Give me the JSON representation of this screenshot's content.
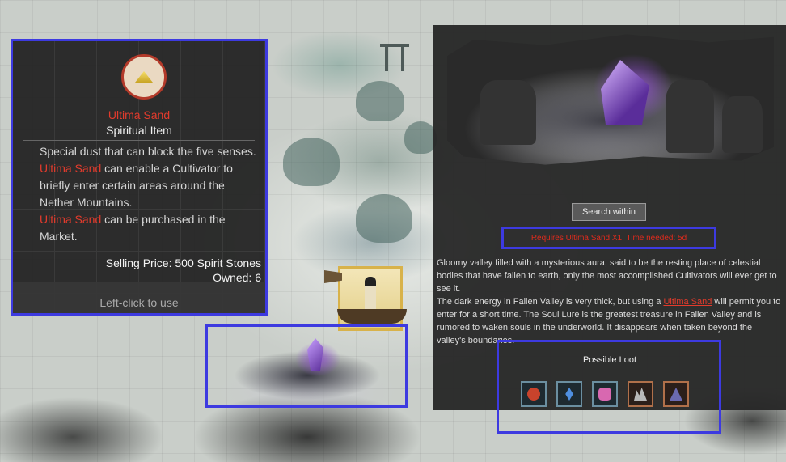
{
  "tooltip": {
    "item_name": "Ultima Sand",
    "item_type": "Spiritual Item",
    "description": [
      {
        "text": "Special dust that can block the five senses. ",
        "highlight": false
      },
      {
        "text": "Ultima Sand",
        "highlight": true
      },
      {
        "text": " can enable a Cultivator to briefly enter certain areas around the Nether Mountains.",
        "highlight": false
      }
    ],
    "description_line2_highlight": "Ultima Sand",
    "description_line2_rest": " can be purchased in the Market.",
    "selling_price": "Selling Price: 500 Spirit Stones",
    "owned": "Owned: 6",
    "use_hint": "Left-click to use"
  },
  "panel": {
    "search_button": "Search within",
    "requirements": "Requires Ultima Sand X1.   Time needed: 5d",
    "desc_para1": " Gloomy valley filled with a mysterious aura, said to be the resting place of celestial bodies that have fallen to earth, only the most accomplished Cultivators will ever get to see it.",
    "desc_para2_pre": " The dark energy in Fallen Valley is very thick, but using a ",
    "desc_para2_link": "Ultima Sand",
    "desc_para2_post": " will permit you to enter for a short time. The Soul Lure is the greatest treasure in Fallen Valley and is rumored to waken souls in the underworld. It disappears when taken beyond the valley's boundaries.",
    "loot_title": "Possible Loot",
    "loot": [
      {
        "icon": "red-orb-icon",
        "rarity": "blue",
        "color": "#c8432c"
      },
      {
        "icon": "blue-crystal-icon",
        "rarity": "blue",
        "color": "#4f8fe0"
      },
      {
        "icon": "pink-gem-icon",
        "rarity": "blue",
        "color": "#d868b0"
      },
      {
        "icon": "silver-ore-icon",
        "rarity": "orange",
        "color": "#b8b8b8"
      },
      {
        "icon": "dark-stone-icon",
        "rarity": "orange",
        "color": "#6a6ab0"
      }
    ]
  },
  "colors": {
    "highlight_box": "#3d3ae0",
    "accent_red": "#e33b2c"
  }
}
